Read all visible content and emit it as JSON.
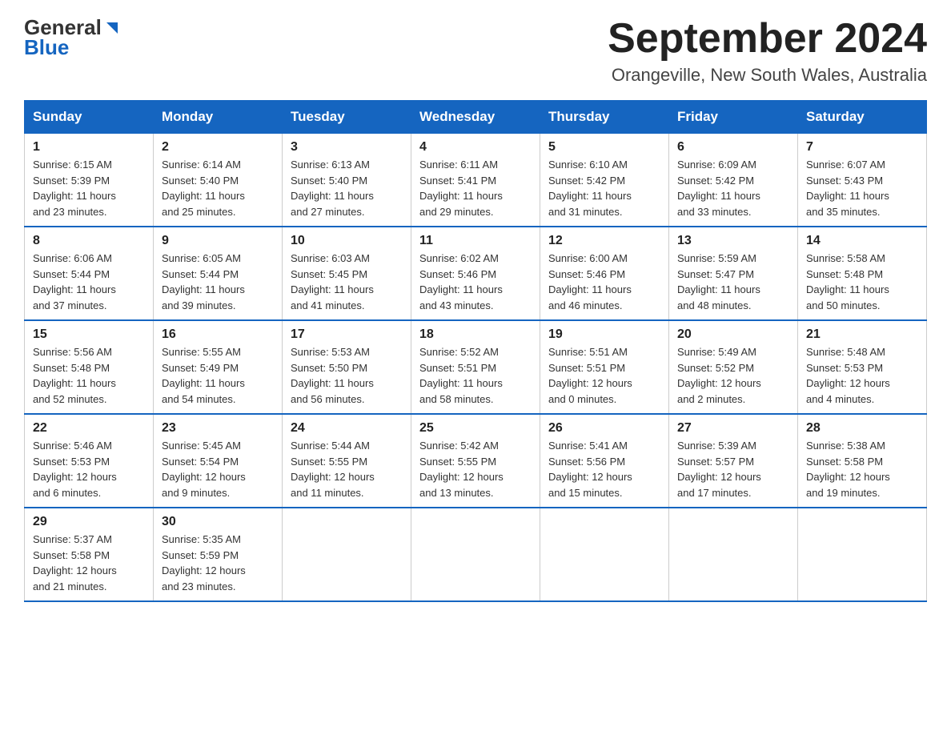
{
  "header": {
    "logo_general": "General",
    "logo_blue": "Blue",
    "month_title": "September 2024",
    "location": "Orangeville, New South Wales, Australia"
  },
  "days_of_week": [
    "Sunday",
    "Monday",
    "Tuesday",
    "Wednesday",
    "Thursday",
    "Friday",
    "Saturday"
  ],
  "weeks": [
    [
      {
        "day": "1",
        "sunrise": "6:15 AM",
        "sunset": "5:39 PM",
        "daylight": "11 hours and 23 minutes."
      },
      {
        "day": "2",
        "sunrise": "6:14 AM",
        "sunset": "5:40 PM",
        "daylight": "11 hours and 25 minutes."
      },
      {
        "day": "3",
        "sunrise": "6:13 AM",
        "sunset": "5:40 PM",
        "daylight": "11 hours and 27 minutes."
      },
      {
        "day": "4",
        "sunrise": "6:11 AM",
        "sunset": "5:41 PM",
        "daylight": "11 hours and 29 minutes."
      },
      {
        "day": "5",
        "sunrise": "6:10 AM",
        "sunset": "5:42 PM",
        "daylight": "11 hours and 31 minutes."
      },
      {
        "day": "6",
        "sunrise": "6:09 AM",
        "sunset": "5:42 PM",
        "daylight": "11 hours and 33 minutes."
      },
      {
        "day": "7",
        "sunrise": "6:07 AM",
        "sunset": "5:43 PM",
        "daylight": "11 hours and 35 minutes."
      }
    ],
    [
      {
        "day": "8",
        "sunrise": "6:06 AM",
        "sunset": "5:44 PM",
        "daylight": "11 hours and 37 minutes."
      },
      {
        "day": "9",
        "sunrise": "6:05 AM",
        "sunset": "5:44 PM",
        "daylight": "11 hours and 39 minutes."
      },
      {
        "day": "10",
        "sunrise": "6:03 AM",
        "sunset": "5:45 PM",
        "daylight": "11 hours and 41 minutes."
      },
      {
        "day": "11",
        "sunrise": "6:02 AM",
        "sunset": "5:46 PM",
        "daylight": "11 hours and 43 minutes."
      },
      {
        "day": "12",
        "sunrise": "6:00 AM",
        "sunset": "5:46 PM",
        "daylight": "11 hours and 46 minutes."
      },
      {
        "day": "13",
        "sunrise": "5:59 AM",
        "sunset": "5:47 PM",
        "daylight": "11 hours and 48 minutes."
      },
      {
        "day": "14",
        "sunrise": "5:58 AM",
        "sunset": "5:48 PM",
        "daylight": "11 hours and 50 minutes."
      }
    ],
    [
      {
        "day": "15",
        "sunrise": "5:56 AM",
        "sunset": "5:48 PM",
        "daylight": "11 hours and 52 minutes."
      },
      {
        "day": "16",
        "sunrise": "5:55 AM",
        "sunset": "5:49 PM",
        "daylight": "11 hours and 54 minutes."
      },
      {
        "day": "17",
        "sunrise": "5:53 AM",
        "sunset": "5:50 PM",
        "daylight": "11 hours and 56 minutes."
      },
      {
        "day": "18",
        "sunrise": "5:52 AM",
        "sunset": "5:51 PM",
        "daylight": "11 hours and 58 minutes."
      },
      {
        "day": "19",
        "sunrise": "5:51 AM",
        "sunset": "5:51 PM",
        "daylight": "12 hours and 0 minutes."
      },
      {
        "day": "20",
        "sunrise": "5:49 AM",
        "sunset": "5:52 PM",
        "daylight": "12 hours and 2 minutes."
      },
      {
        "day": "21",
        "sunrise": "5:48 AM",
        "sunset": "5:53 PM",
        "daylight": "12 hours and 4 minutes."
      }
    ],
    [
      {
        "day": "22",
        "sunrise": "5:46 AM",
        "sunset": "5:53 PM",
        "daylight": "12 hours and 6 minutes."
      },
      {
        "day": "23",
        "sunrise": "5:45 AM",
        "sunset": "5:54 PM",
        "daylight": "12 hours and 9 minutes."
      },
      {
        "day": "24",
        "sunrise": "5:44 AM",
        "sunset": "5:55 PM",
        "daylight": "12 hours and 11 minutes."
      },
      {
        "day": "25",
        "sunrise": "5:42 AM",
        "sunset": "5:55 PM",
        "daylight": "12 hours and 13 minutes."
      },
      {
        "day": "26",
        "sunrise": "5:41 AM",
        "sunset": "5:56 PM",
        "daylight": "12 hours and 15 minutes."
      },
      {
        "day": "27",
        "sunrise": "5:39 AM",
        "sunset": "5:57 PM",
        "daylight": "12 hours and 17 minutes."
      },
      {
        "day": "28",
        "sunrise": "5:38 AM",
        "sunset": "5:58 PM",
        "daylight": "12 hours and 19 minutes."
      }
    ],
    [
      {
        "day": "29",
        "sunrise": "5:37 AM",
        "sunset": "5:58 PM",
        "daylight": "12 hours and 21 minutes."
      },
      {
        "day": "30",
        "sunrise": "5:35 AM",
        "sunset": "5:59 PM",
        "daylight": "12 hours and 23 minutes."
      },
      null,
      null,
      null,
      null,
      null
    ]
  ],
  "labels": {
    "sunrise": "Sunrise:",
    "sunset": "Sunset:",
    "daylight": "Daylight:"
  }
}
